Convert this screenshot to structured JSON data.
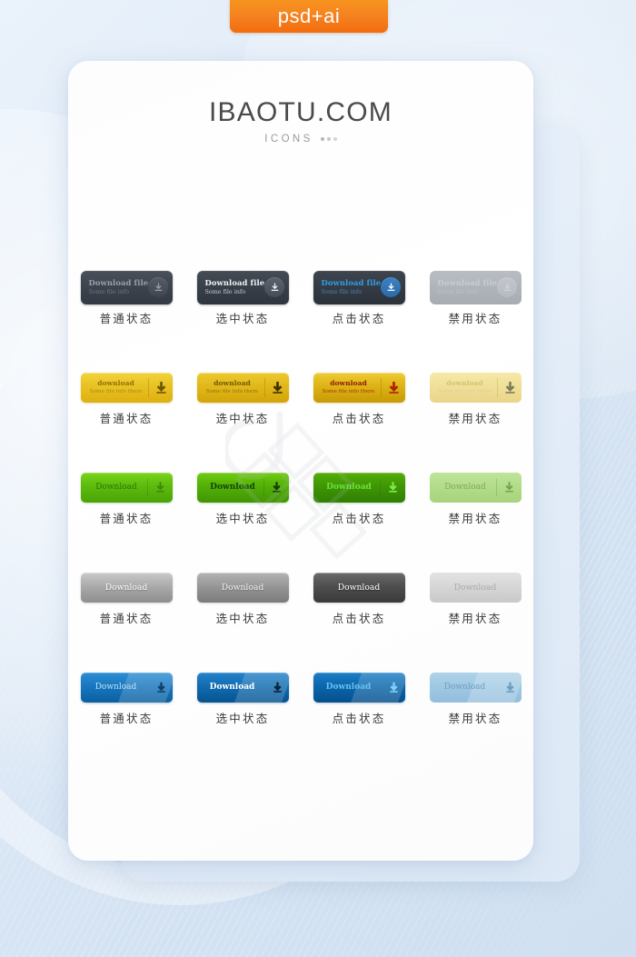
{
  "badge": {
    "label": "psd+ai",
    "color": "#f58220"
  },
  "header": {
    "title": "IBAOTU.COM",
    "subtitle": "ICONS"
  },
  "states": {
    "normal": "普通状态",
    "selected": "选中状态",
    "pressed": "点击状态",
    "disabled": "禁用状态"
  },
  "rows": [
    {
      "name": "dark-download-file",
      "style": "dark",
      "primary": "Download file",
      "secondary": "Some file info",
      "icon": "download-circle-icon",
      "colors": {
        "base": "#3c424b",
        "pressed_text": "#2f9fe8",
        "disabled": "#aeb3ba"
      },
      "cells": [
        {
          "state": "normal",
          "label": "普通状态"
        },
        {
          "state": "selected",
          "label": "选中状态"
        },
        {
          "state": "pressed",
          "label": "点击状态"
        },
        {
          "state": "disabled",
          "label": "禁用状态"
        }
      ]
    },
    {
      "name": "yellow-download",
      "style": "yellow",
      "primary": "download",
      "secondary": "Some file info there",
      "icon": "download-arrow-icon",
      "colors": {
        "base": "#e9c324",
        "pressed_text": "#8d1b09",
        "disabled": "#f0e098"
      },
      "cells": [
        {
          "state": "normal",
          "label": "普通状态"
        },
        {
          "state": "selected",
          "label": "选中状态"
        },
        {
          "state": "pressed",
          "label": "点击状态"
        },
        {
          "state": "disabled",
          "label": "禁用状态"
        }
      ]
    },
    {
      "name": "green-download",
      "style": "green",
      "primary": "Download",
      "secondary": "",
      "icon": "download-arrow-icon",
      "colors": {
        "base": "#5dbb0d",
        "pressed_text": "#6ce23a",
        "disabled": "#b2dc89"
      },
      "cells": [
        {
          "state": "normal",
          "label": "普通状态"
        },
        {
          "state": "selected",
          "label": "选中状态"
        },
        {
          "state": "pressed",
          "label": "点击状态"
        },
        {
          "state": "disabled",
          "label": "禁用状态"
        }
      ]
    },
    {
      "name": "silver-download",
      "style": "silver",
      "primary": "Download",
      "secondary": "",
      "icon": "",
      "colors": {
        "base": "#a9a9a9",
        "pressed_text": "#ffffff",
        "disabled": "#d6d6d6"
      },
      "cells": [
        {
          "state": "normal",
          "label": "普通状态"
        },
        {
          "state": "selected",
          "label": "选中状态"
        },
        {
          "state": "pressed",
          "label": "点击状态"
        },
        {
          "state": "disabled",
          "label": "禁用状态"
        }
      ]
    },
    {
      "name": "blue-download",
      "style": "blue",
      "primary": "Download",
      "secondary": "",
      "icon": "download-arrow-icon",
      "colors": {
        "base": "#1877bf",
        "pressed_text": "#63c3f2",
        "disabled": "#9fc8e3"
      },
      "cells": [
        {
          "state": "normal",
          "label": "普通状态"
        },
        {
          "state": "selected",
          "label": "选中状态"
        },
        {
          "state": "pressed",
          "label": "点击状态"
        },
        {
          "state": "disabled",
          "label": "禁用状态"
        }
      ]
    }
  ]
}
